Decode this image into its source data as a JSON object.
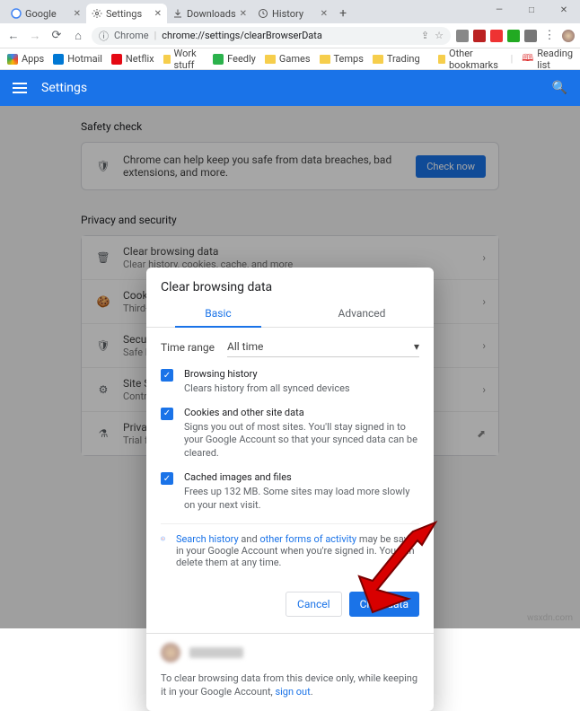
{
  "window": {
    "minimize": "—",
    "maximize": "□",
    "close": "✕"
  },
  "tabs": [
    {
      "title": "Google"
    },
    {
      "title": "Settings"
    },
    {
      "title": "Downloads"
    },
    {
      "title": "History"
    }
  ],
  "toolbar": {
    "secure_label": "Chrome",
    "url": "chrome://settings/clearBrowserData"
  },
  "bookmarks": {
    "apps": "Apps",
    "items": [
      "Hotmail",
      "Netflix",
      "Work stuff",
      "Feedly",
      "Games",
      "Temps",
      "Trading"
    ],
    "other": "Other bookmarks",
    "reading": "Reading list"
  },
  "settings_header": {
    "title": "Settings"
  },
  "safety": {
    "section": "Safety check",
    "text": "Chrome can help keep you safe from data breaches, bad extensions, and more.",
    "button": "Check now"
  },
  "privacy": {
    "section": "Privacy and security",
    "rows": [
      {
        "title": "Clear browsing data",
        "sub": "Clear history, cookies, cache, and more"
      },
      {
        "title": "Cookies and other site data",
        "sub": "Third-party cookies are blocked in Incognito mode"
      },
      {
        "title": "Security",
        "sub": "Safe Browsing and other security settings"
      },
      {
        "title": "Site Settings",
        "sub": "Controls what information sites can use"
      },
      {
        "title": "Privacy Sandbox",
        "sub": "Trial features are on"
      }
    ]
  },
  "dialog": {
    "title": "Clear browsing data",
    "tab_basic": "Basic",
    "tab_advanced": "Advanced",
    "time_label": "Time range",
    "time_value": "All time",
    "items": [
      {
        "title": "Browsing history",
        "sub": "Clears history from all synced devices"
      },
      {
        "title": "Cookies and other site data",
        "sub": "Signs you out of most sites. You'll stay signed in to your Google Account so that your synced data can be cleared."
      },
      {
        "title": "Cached images and files",
        "sub": "Frees up 132 MB. Some sites may load more slowly on your next visit."
      }
    ],
    "info_link1": "Search history",
    "info_mid": " and ",
    "info_link2": "other forms of activity",
    "info_rest": " may be saved in your Google Account when you're signed in. You can delete them at any time.",
    "cancel": "Cancel",
    "clear": "Clear data",
    "signout_pre": "To clear browsing data from this device only, while keeping it in your Google Account, ",
    "signout_link": "sign out",
    "signout_post": "."
  },
  "watermark": "wsxdn.com"
}
